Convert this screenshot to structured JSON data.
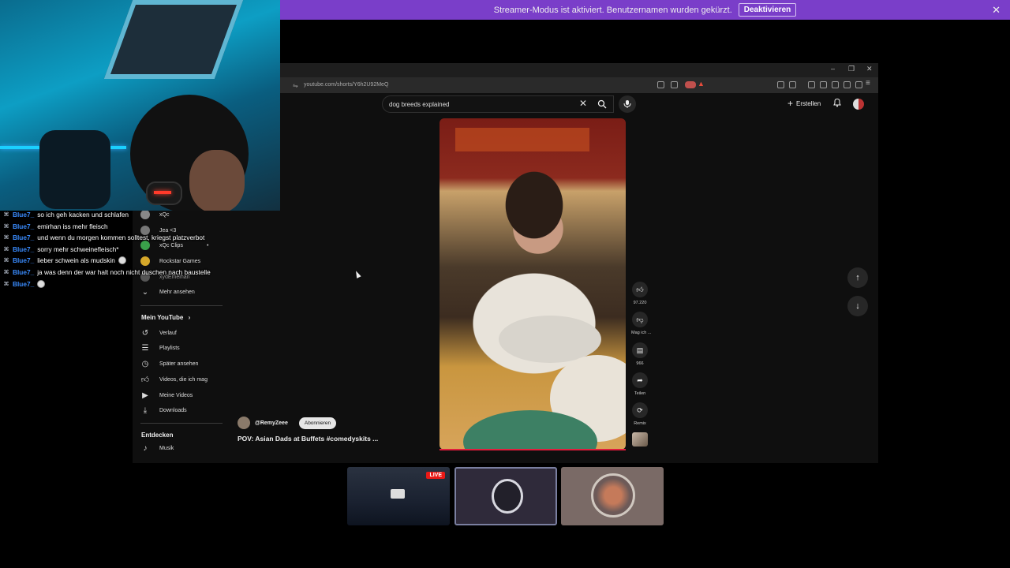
{
  "banner": {
    "text": "Streamer-Modus ist aktiviert. Benutzernamen wurden gekürzt.",
    "button": "Deaktivieren",
    "color": "#7a3ec9"
  },
  "browser": {
    "url": "youtube.com/shorts/Y6h2U92MeQ"
  },
  "youtube": {
    "search_value": "dog breeds explained",
    "create_label": "Erstellen",
    "sidebar": {
      "subscriptions": [
        {
          "label": "xQc"
        },
        {
          "label": "Jea <3"
        },
        {
          "label": "xQc Clips"
        },
        {
          "label": "Rockstar Games"
        },
        {
          "label": "xydEmeihan"
        }
      ],
      "more_label": "Mehr ansehen",
      "my_youtube_heading": "Mein YouTube",
      "my_youtube_items": [
        {
          "label": "Verlauf",
          "icon": "history-icon"
        },
        {
          "label": "Playlists",
          "icon": "playlist-icon"
        },
        {
          "label": "Später ansehen",
          "icon": "clock-icon"
        },
        {
          "label": "Videos, die ich mag",
          "icon": "thumbs-up-icon"
        },
        {
          "label": "Meine Videos",
          "icon": "play-icon"
        },
        {
          "label": "Downloads",
          "icon": "download-icon"
        }
      ],
      "explore_heading": "Entdecken",
      "explore_items": [
        {
          "label": "Musik",
          "icon": "music-icon"
        }
      ]
    },
    "short": {
      "channel": "@RemyZeee",
      "subscribe_label": "Abonnieren",
      "title": "POV: Asian Dads at Buffets #comedyskits ...",
      "likes": "97.220",
      "dislike_label": "Mag ich ...",
      "comments": "966",
      "share_label": "Teilen",
      "remix_label": "Remix",
      "progress_color": "#e21d3c"
    }
  },
  "chat": {
    "username_color": "#3a8cff",
    "messages": [
      {
        "user": "Blue7_",
        "text": "so ich geh kacken und schlafen"
      },
      {
        "user": "Blue7_",
        "text": "emirhan iss mehr fleisch"
      },
      {
        "user": "Blue7_",
        "text": "und wenn du morgen kommen solltest, kriegst platzverbot"
      },
      {
        "user": "Blue7_",
        "text": "sorry mehr schweinefleisch*"
      },
      {
        "user": "Blue7_",
        "text": "lieber schwein als mudskin"
      },
      {
        "user": "Blue7_",
        "text": "ja was denn der war halt noch nicht duschen nach baustelle"
      },
      {
        "user": "Blue7_",
        "text": ""
      }
    ]
  },
  "thumbnails": {
    "live_badge": "LIVE"
  }
}
